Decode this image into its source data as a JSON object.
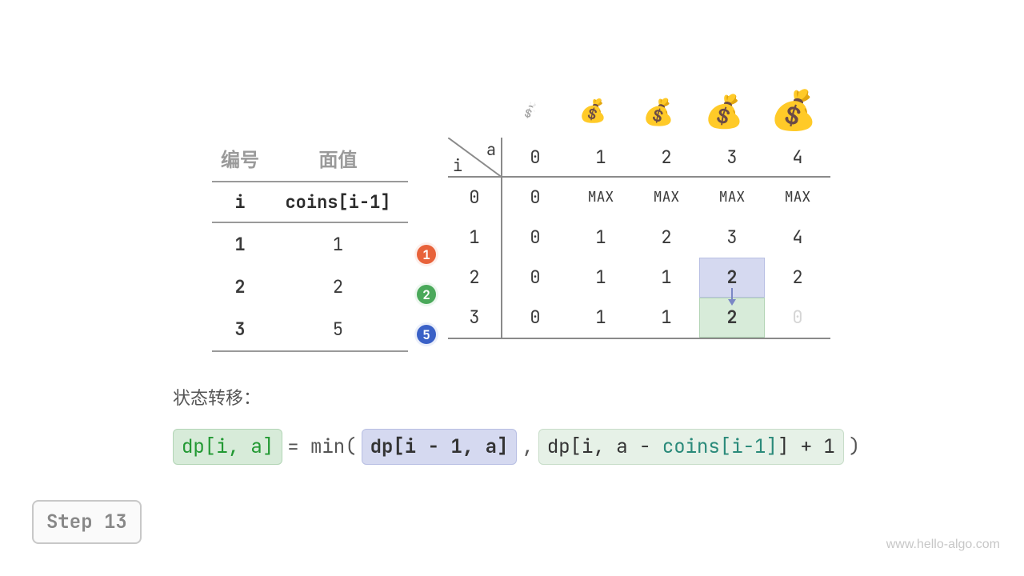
{
  "coins_table": {
    "head_index": "编号",
    "head_value": "面值",
    "sub_index": "i",
    "sub_value": "coins[i-1]",
    "rows": [
      {
        "i": "1",
        "v": "1",
        "badge": "1"
      },
      {
        "i": "2",
        "v": "2",
        "badge": "2"
      },
      {
        "i": "3",
        "v": "5",
        "badge": "5"
      }
    ]
  },
  "dp": {
    "axis_a": "a",
    "axis_i": "i",
    "a_headers": [
      "0",
      "1",
      "2",
      "3",
      "4"
    ],
    "i_headers": [
      "0",
      "1",
      "2",
      "3"
    ],
    "cells": [
      [
        "0",
        "MAX",
        "MAX",
        "MAX",
        "MAX"
      ],
      [
        "0",
        "1",
        "2",
        "3",
        "4"
      ],
      [
        "0",
        "1",
        "1",
        "2",
        "2"
      ],
      [
        "0",
        "1",
        "1",
        "2",
        "0"
      ]
    ],
    "highlight_from": {
      "row": 2,
      "col": 3
    },
    "highlight_to": {
      "row": 3,
      "col": 3
    },
    "faded": {
      "row": 3,
      "col": 4
    },
    "bold_cells": [
      [
        2,
        3
      ],
      [
        3,
        3
      ]
    ]
  },
  "bags": {
    "icons": [
      "💰",
      "💰",
      "💰",
      "💰",
      "💰"
    ],
    "sizes": [
      22,
      28,
      32,
      38,
      44
    ]
  },
  "formula": {
    "label": "状态转移：",
    "lhs": "dp[i, a]",
    "eq": " = min(",
    "arg1": "dp[i − 1, a]",
    "comma": ",",
    "arg2_pre": "dp[i, a − ",
    "arg2_coins": "coins[i-1]",
    "arg2_post": "] + 1",
    "close": ")"
  },
  "step": "Step 13",
  "watermark": "www.hello-algo.com",
  "chart_data": {
    "type": "table",
    "title": "Coin Change DP table (step 13)",
    "coins": [
      1,
      2,
      5
    ],
    "amounts": [
      0,
      1,
      2,
      3,
      4
    ],
    "dp_rows": [
      {
        "i": 0,
        "values": [
          0,
          "MAX",
          "MAX",
          "MAX",
          "MAX"
        ]
      },
      {
        "i": 1,
        "coin": 1,
        "values": [
          0,
          1,
          2,
          3,
          4
        ]
      },
      {
        "i": 2,
        "coin": 2,
        "values": [
          0,
          1,
          1,
          2,
          2
        ]
      },
      {
        "i": 3,
        "coin": 5,
        "values": [
          0,
          1,
          1,
          2,
          null
        ]
      }
    ],
    "current_transition": {
      "target": {
        "i": 3,
        "a": 3,
        "value": 2
      },
      "source_top": {
        "i": 2,
        "a": 3,
        "value": 2
      },
      "formula": "dp[i,a] = min(dp[i-1,a], dp[i, a-coins[i-1]] + 1)"
    }
  }
}
